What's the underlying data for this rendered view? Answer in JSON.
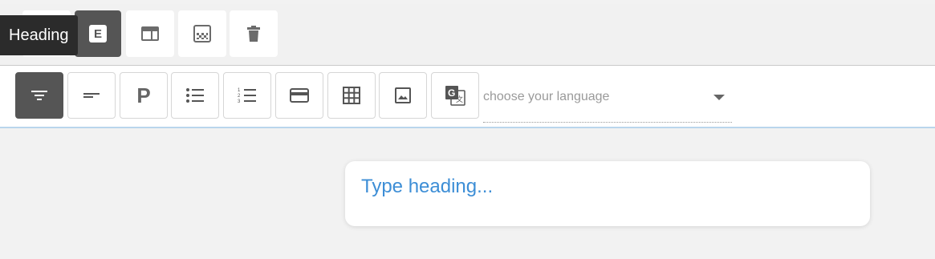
{
  "tooltip": {
    "text": "Heading"
  },
  "top_toolbar": {
    "buttons": [
      {
        "name": "heading-block",
        "icon": "letter-e-icon",
        "glyph": "E",
        "active": true
      },
      {
        "name": "layout-block",
        "icon": "layout-icon",
        "active": false
      },
      {
        "name": "background-block",
        "icon": "background-pattern-icon",
        "active": false
      },
      {
        "name": "delete-block",
        "icon": "trash-icon",
        "active": false
      }
    ]
  },
  "format_toolbar": {
    "buttons": [
      {
        "name": "filter-align",
        "icon": "filter-icon",
        "active": true
      },
      {
        "name": "short-line",
        "icon": "short-line-icon",
        "active": false
      },
      {
        "name": "paragraph",
        "icon": "paragraph-icon",
        "glyph": "P",
        "active": false
      },
      {
        "name": "bullet-list",
        "icon": "bullet-list-icon",
        "active": false
      },
      {
        "name": "numbered-list",
        "icon": "numbered-list-icon",
        "active": false
      },
      {
        "name": "card",
        "icon": "card-icon",
        "active": false
      },
      {
        "name": "table",
        "icon": "table-icon",
        "active": false
      },
      {
        "name": "image",
        "icon": "image-icon",
        "active": false
      },
      {
        "name": "translate",
        "icon": "google-translate-icon",
        "active": false
      }
    ],
    "language_select": {
      "placeholder": "choose your language"
    }
  },
  "editor": {
    "heading_placeholder": "Type heading..."
  },
  "colors": {
    "accent": "#3d8ed6",
    "active_button": "#555555",
    "tooltip_bg": "#2b2b2b"
  }
}
